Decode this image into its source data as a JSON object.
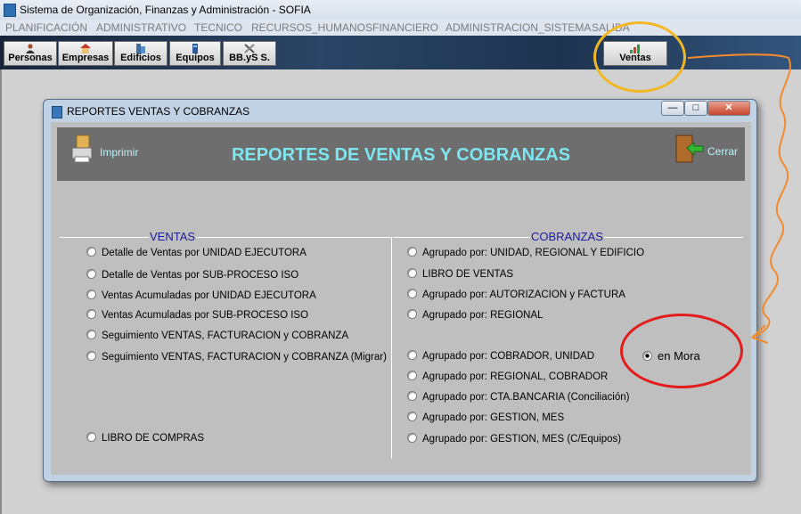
{
  "app": {
    "title": "Sistema de Organización, Finanzas y Administración - SOFIA"
  },
  "menu": [
    "PLANIFICACIÓN",
    "ADMINISTRATIVO",
    "TECNICO",
    "RECURSOS_HUMANOS",
    "FINANCIERO",
    "ADMINISTRACION_SISTEMA",
    "SALIDA"
  ],
  "toolbar": [
    "Personas",
    "Empresas",
    "Edificios",
    "Equipos",
    "BB.yS S."
  ],
  "ventas_button": "Ventas",
  "dialog": {
    "title": "REPORTES VENTAS Y COBRANZAS",
    "header_title": "REPORTES DE VENTAS Y COBRANZAS",
    "print_label": "Imprimir",
    "close_label": "Cerrar"
  },
  "ventas": {
    "legend": "VENTAS",
    "options": [
      "Detalle de Ventas por UNIDAD EJECUTORA",
      "Detalle de Ventas por SUB-PROCESO ISO",
      "Ventas Acumuladas por UNIDAD EJECUTORA",
      "Ventas Acumuladas por SUB-PROCESO ISO",
      "Seguimiento VENTAS, FACTURACION y COBRANZA",
      "Seguimiento VENTAS, FACTURACION y COBRANZA (Migrar)"
    ],
    "compras": "LIBRO DE COMPRAS"
  },
  "cobranzas": {
    "legend": "COBRANZAS",
    "options": [
      "Agrupado por: UNIDAD, REGIONAL Y EDIFICIO",
      "LIBRO DE VENTAS",
      "Agrupado por: AUTORIZACION y FACTURA",
      "Agrupado por: REGIONAL",
      "Agrupado por: COBRADOR, UNIDAD",
      "Agrupado por: REGIONAL, COBRADOR",
      "Agrupado por: CTA.BANCARIA (Conciliación)",
      "Agrupado por: GESTION, MES",
      "Agrupado por: GESTION, MES (C/Equipos)"
    ],
    "en_mora": "en Mora",
    "en_mora_checked": true
  },
  "colors": {
    "header_title": "#7fe6f0",
    "legend": "#1a1a9e",
    "annotation_yellow": "#f0b825",
    "annotation_red": "#e21b1b",
    "annotation_orange": "#f28a2e"
  }
}
